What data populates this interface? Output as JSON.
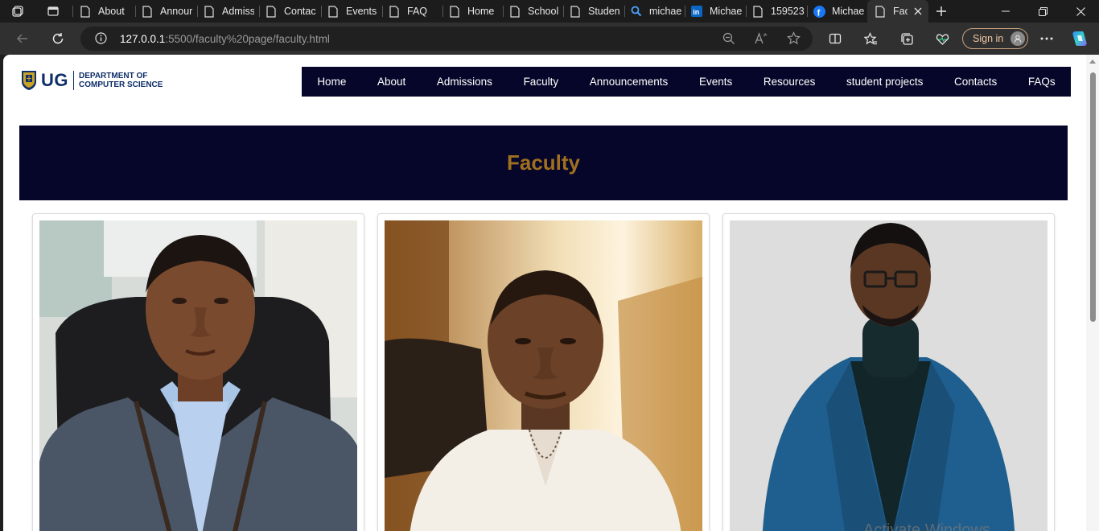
{
  "browser": {
    "tabs": [
      {
        "label": "About",
        "icon": "page-icon"
      },
      {
        "label": "Annour",
        "icon": "page-icon"
      },
      {
        "label": "Admiss",
        "icon": "page-icon"
      },
      {
        "label": "Contac",
        "icon": "page-icon"
      },
      {
        "label": "Events",
        "icon": "page-icon"
      },
      {
        "label": "FAQ",
        "icon": "page-icon"
      },
      {
        "label": "Home",
        "icon": "page-icon"
      },
      {
        "label": "School",
        "icon": "page-icon"
      },
      {
        "label": "Studen",
        "icon": "page-icon"
      },
      {
        "label": "michae",
        "icon": "search-icon"
      },
      {
        "label": "Michae",
        "icon": "linkedin-icon"
      },
      {
        "label": "159523",
        "icon": "page-icon"
      },
      {
        "label": "Michae",
        "icon": "facebook-icon"
      },
      {
        "label": "Fac",
        "icon": "page-icon",
        "active": true
      }
    ],
    "url_host": "127.0.0.1",
    "url_path": ":5500/faculty%20page/faculty.html",
    "signin_label": "Sign in"
  },
  "site": {
    "logo": {
      "short": "UG",
      "line1": "DEPARTMENT OF",
      "line2": "COMPUTER SCIENCE"
    },
    "nav": [
      "Home",
      "About",
      "Admissions",
      "Faculty",
      "Announcements",
      "Events",
      "Resources",
      "student projects",
      "Contacts",
      "FAQs"
    ],
    "banner_title": "Faculty",
    "colors": {
      "nav_bg": "#06062a",
      "banner_title": "#a06f1f",
      "logo_blue": "#0f2f68"
    }
  },
  "os": {
    "watermark": "Activate Windows"
  }
}
